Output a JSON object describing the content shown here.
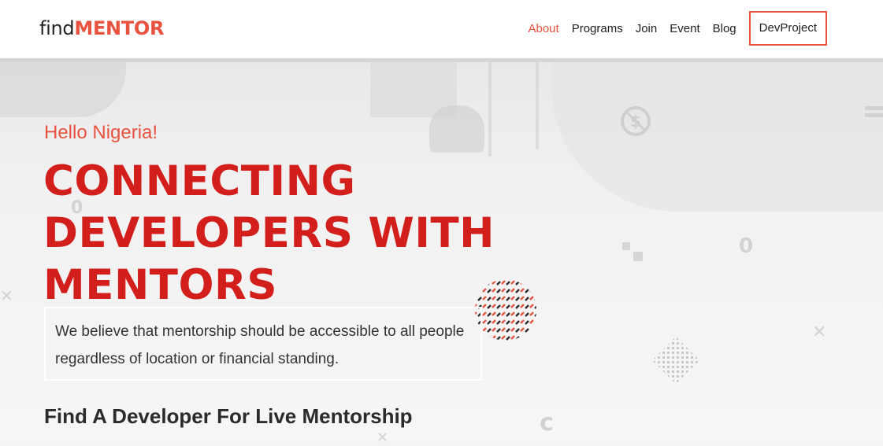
{
  "logo": {
    "part1": "find",
    "part2": "MENTOR"
  },
  "nav": {
    "about": "About",
    "programs": "Programs",
    "join": "Join",
    "event": "Event",
    "blog": "Blog",
    "devproject": "DevProject"
  },
  "hero": {
    "greeting": "Hello Nigeria!",
    "headline": "CONNECTING DEVELOPERS WITH MENTORS",
    "tagline": "We believe that mentorship should be accessible to all people regardless of location or financial standing.",
    "subhead": "Find A Developer For Live Mentorship"
  },
  "colors": {
    "accent": "#e8533f",
    "headline": "#d21f1b",
    "background": "#f4f4f4"
  },
  "icons": [
    "dollar-coin-icon",
    "zero-glyph-icon",
    "x-cross-icon",
    "dots-pattern-icon"
  ]
}
